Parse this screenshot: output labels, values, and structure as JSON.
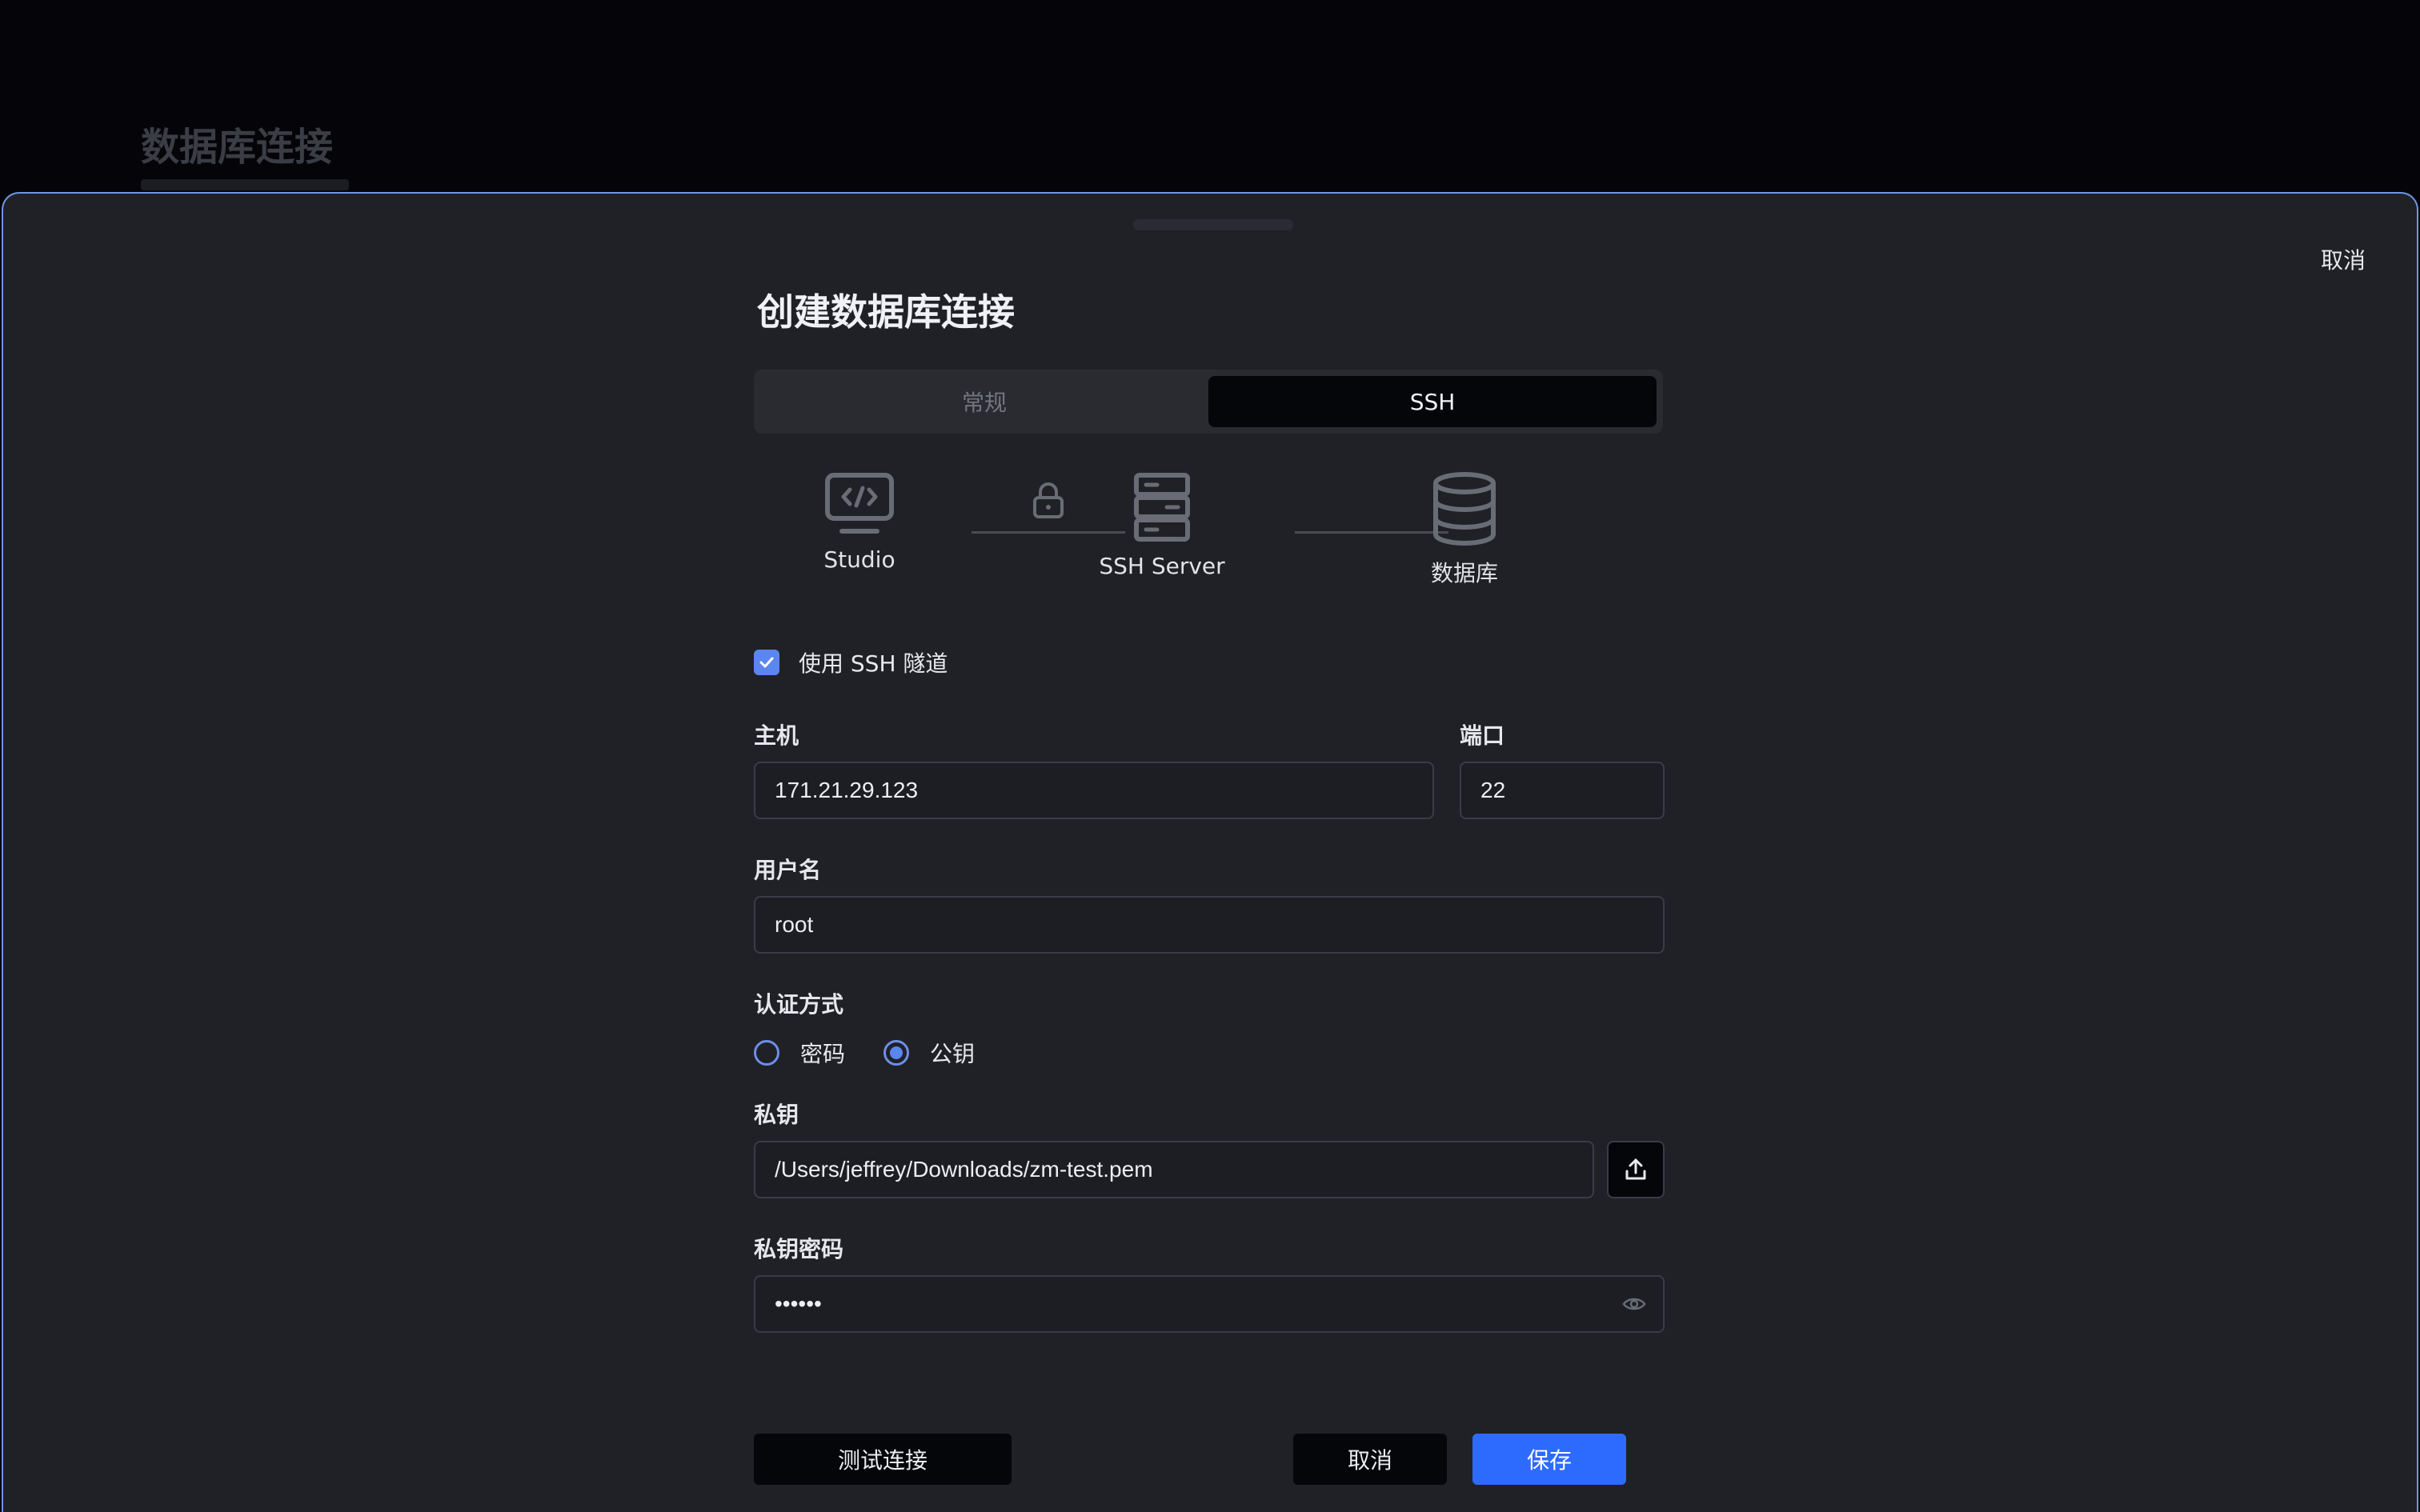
{
  "background": {
    "title": "数据库连接"
  },
  "sheet": {
    "cancel_label": "取消",
    "title": "创建数据库连接",
    "tabs": [
      {
        "label": "常规",
        "active": false
      },
      {
        "label": "SSH",
        "active": true
      }
    ],
    "tunnel": {
      "nodes": [
        {
          "label": "Studio",
          "icon": "monitor-code-icon"
        },
        {
          "label": "SSH Server",
          "icon": "server-icon"
        },
        {
          "label": "数据库",
          "icon": "database-icon"
        }
      ],
      "link_icon": "lock-icon"
    },
    "use_ssh": {
      "label": "使用 SSH 隧道",
      "checked": true
    },
    "host": {
      "label": "主机",
      "value": "171.21.29.123"
    },
    "port": {
      "label": "端口",
      "value": "22"
    },
    "username": {
      "label": "用户名",
      "value": "root"
    },
    "auth": {
      "label": "认证方式",
      "options": [
        {
          "label": "密码",
          "selected": false
        },
        {
          "label": "公钥",
          "selected": true
        }
      ]
    },
    "private_key": {
      "label": "私钥",
      "value": "/Users/jeffrey/Downloads/zm-test.pem",
      "upload_icon": "upload-icon"
    },
    "key_password": {
      "label": "私钥密码",
      "value": "••••••",
      "toggle_icon": "eye-icon"
    },
    "buttons": {
      "test": "测试连接",
      "cancel": "取消",
      "save": "保存"
    },
    "colors": {
      "accent": "#2d6bff",
      "checkbox": "#5b86f0",
      "sheet_border": "#6f95e6"
    }
  }
}
